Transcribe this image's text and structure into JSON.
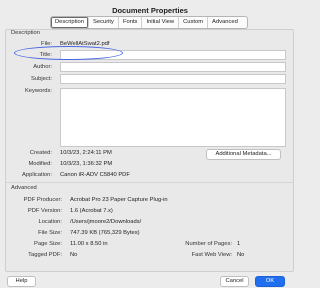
{
  "window": {
    "title": "Document Properties"
  },
  "tabs": [
    "Description",
    "Security",
    "Fonts",
    "Initial View",
    "Custom",
    "Advanced"
  ],
  "description": {
    "section": "Description",
    "file_label": "File:",
    "file_value": "BeWellAtSwat2.pdf",
    "title_label": "Title:",
    "title_value": "",
    "author_label": "Author:",
    "author_value": "",
    "subject_label": "Subject:",
    "subject_value": "",
    "keywords_label": "Keywords:",
    "keywords_value": "",
    "created_label": "Created:",
    "created_value": "10/3/23, 2:24:11 PM",
    "modified_label": "Modified:",
    "modified_value": "10/3/23, 1:36:32 PM",
    "application_label": "Application:",
    "application_value": "Canon iR-ADV C5840  PDF",
    "additional_metadata": "Additional Metadata..."
  },
  "advanced": {
    "section": "Advanced",
    "producer_label": "PDF Producer:",
    "producer_value": "Acrobat Pro 23 Paper Capture Plug-in",
    "version_label": "PDF Version:",
    "version_value": "1.6 (Acrobat 7.x)",
    "location_label": "Location:",
    "location_value": "/Users/jmoore2/Downloads/",
    "filesize_label": "File Size:",
    "filesize_value": "747.39 KB (765,329 Bytes)",
    "pagesize_label": "Page Size:",
    "pagesize_value": "11.00 x 8.50 in",
    "pages_label": "Number of Pages:",
    "pages_value": "1",
    "tagged_label": "Tagged PDF:",
    "tagged_value": "No",
    "fastweb_label": "Fast Web View:",
    "fastweb_value": "No"
  },
  "footer": {
    "help": "Help",
    "cancel": "Cancel",
    "ok": "OK"
  },
  "colors": {
    "accent": "#1f6ff0",
    "annotation": "#4a67e3"
  }
}
